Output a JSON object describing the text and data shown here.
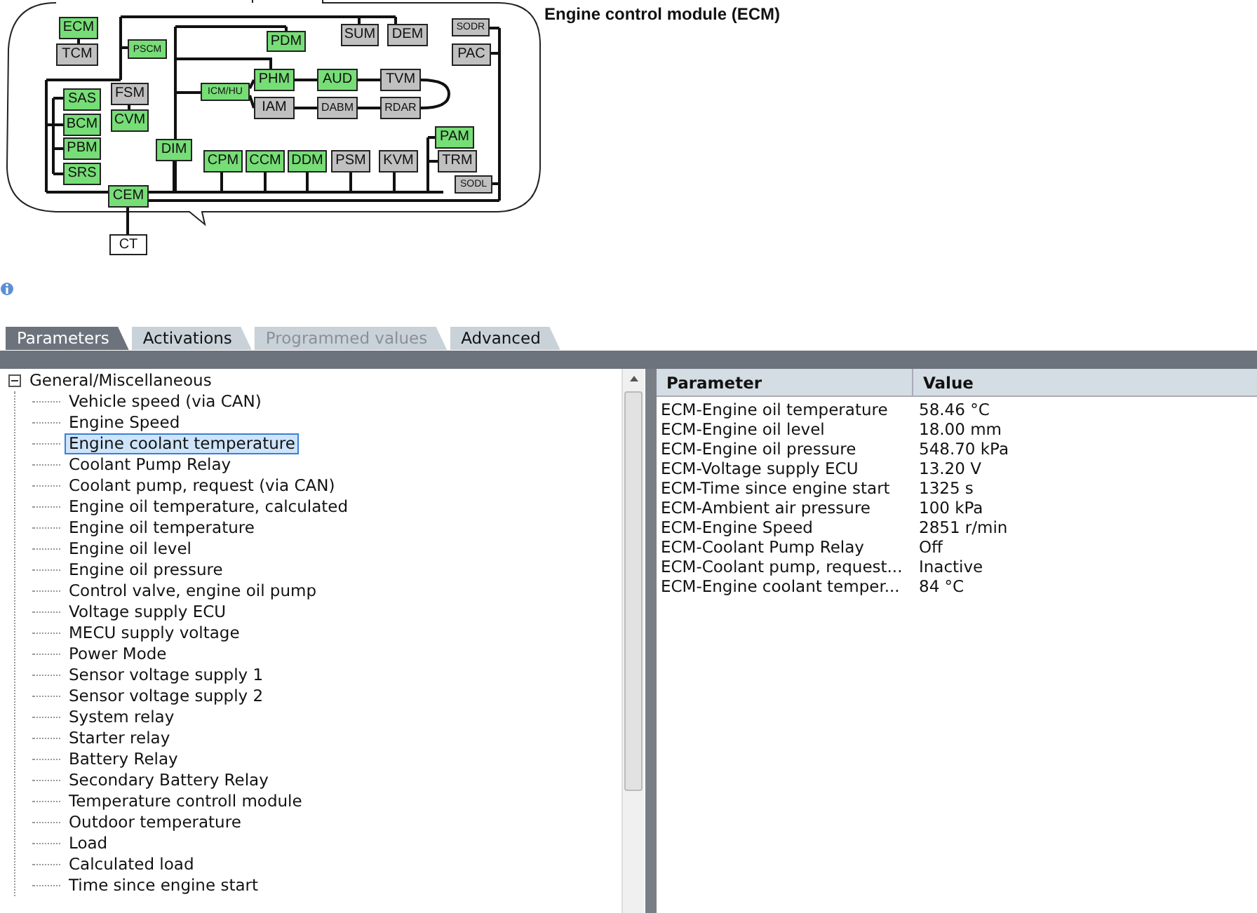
{
  "module_title": "Engine control module (ECM)",
  "network_nodes": [
    {
      "label": "ECM",
      "color": "#77dd77"
    },
    {
      "label": "TCM",
      "color": "#c0c0c0"
    },
    {
      "label": "PSCM",
      "color": "#77dd77"
    },
    {
      "label": "PDM",
      "color": "#77dd77"
    },
    {
      "label": "SUM",
      "color": "#c0c0c0"
    },
    {
      "label": "DEM",
      "color": "#c0c0c0"
    },
    {
      "label": "SODR",
      "color": "#c0c0c0"
    },
    {
      "label": "PAC",
      "color": "#c0c0c0"
    },
    {
      "label": "PHM",
      "color": "#77dd77"
    },
    {
      "label": "AUD",
      "color": "#77dd77"
    },
    {
      "label": "TVM",
      "color": "#c0c0c0"
    },
    {
      "label": "ICM/HU",
      "color": "#77dd77"
    },
    {
      "label": "IAM",
      "color": "#c0c0c0"
    },
    {
      "label": "DABM",
      "color": "#c0c0c0"
    },
    {
      "label": "RDAR",
      "color": "#c0c0c0"
    },
    {
      "label": "SAS",
      "color": "#77dd77"
    },
    {
      "label": "FSM",
      "color": "#c0c0c0"
    },
    {
      "label": "BCM",
      "color": "#77dd77"
    },
    {
      "label": "CVM",
      "color": "#77dd77"
    },
    {
      "label": "PBM",
      "color": "#77dd77"
    },
    {
      "label": "SRS",
      "color": "#77dd77"
    },
    {
      "label": "DIM",
      "color": "#77dd77"
    },
    {
      "label": "CPM",
      "color": "#77dd77"
    },
    {
      "label": "CCM",
      "color": "#77dd77"
    },
    {
      "label": "DDM",
      "color": "#77dd77"
    },
    {
      "label": "PSM",
      "color": "#c0c0c0"
    },
    {
      "label": "KVM",
      "color": "#c0c0c0"
    },
    {
      "label": "PAM",
      "color": "#77dd77"
    },
    {
      "label": "TRM",
      "color": "#c0c0c0"
    },
    {
      "label": "SODL",
      "color": "#c0c0c0"
    },
    {
      "label": "CEM",
      "color": "#77dd77"
    },
    {
      "label": "CT",
      "color": "#ffffff"
    }
  ],
  "tabs": [
    {
      "label": "Parameters",
      "selected": true,
      "disabled": false
    },
    {
      "label": "Activations",
      "selected": false,
      "disabled": false
    },
    {
      "label": "Programmed values",
      "selected": false,
      "disabled": true
    },
    {
      "label": "Advanced",
      "selected": false,
      "disabled": false
    }
  ],
  "tree": {
    "label": "General/Miscellaneous",
    "expanded": true,
    "children": [
      {
        "label": "Vehicle speed (via CAN)",
        "selected": false
      },
      {
        "label": "Engine Speed",
        "selected": false
      },
      {
        "label": "Engine coolant temperature",
        "selected": true
      },
      {
        "label": "Coolant Pump Relay",
        "selected": false
      },
      {
        "label": "Coolant pump, request (via CAN)",
        "selected": false
      },
      {
        "label": "Engine oil temperature, calculated",
        "selected": false
      },
      {
        "label": "Engine oil temperature",
        "selected": false
      },
      {
        "label": "Engine oil level",
        "selected": false
      },
      {
        "label": "Engine oil pressure",
        "selected": false
      },
      {
        "label": "Control valve, engine oil pump",
        "selected": false
      },
      {
        "label": "Voltage supply ECU",
        "selected": false
      },
      {
        "label": "MECU supply voltage",
        "selected": false
      },
      {
        "label": "Power Mode",
        "selected": false
      },
      {
        "label": "Sensor voltage supply 1",
        "selected": false
      },
      {
        "label": "Sensor voltage supply 2",
        "selected": false
      },
      {
        "label": "System relay",
        "selected": false
      },
      {
        "label": "Starter relay",
        "selected": false
      },
      {
        "label": "Battery Relay",
        "selected": false
      },
      {
        "label": "Secondary Battery Relay",
        "selected": false
      },
      {
        "label": "Temperature controll module",
        "selected": false
      },
      {
        "label": "Outdoor temperature",
        "selected": false
      },
      {
        "label": "Load",
        "selected": false
      },
      {
        "label": "Calculated load",
        "selected": false
      },
      {
        "label": "Time since engine start",
        "selected": false
      }
    ]
  },
  "table": {
    "columns": [
      "Parameter",
      "Value"
    ],
    "rows": [
      [
        "ECM-Engine oil temperature",
        "58.46 °C"
      ],
      [
        "ECM-Engine oil level",
        "18.00 mm"
      ],
      [
        "ECM-Engine oil pressure",
        "548.70 kPa"
      ],
      [
        "ECM-Voltage supply ECU",
        "13.20 V"
      ],
      [
        "ECM-Time since engine start",
        "1325 s"
      ],
      [
        "ECM-Ambient air pressure",
        "100 kPa"
      ],
      [
        "ECM-Engine Speed",
        "2851 r/min"
      ],
      [
        "ECM-Coolant Pump Relay",
        "Off"
      ],
      [
        "ECM-Coolant pump, request...",
        "Inactive"
      ],
      [
        "ECM-Engine coolant temper...",
        "84 °C"
      ]
    ]
  }
}
